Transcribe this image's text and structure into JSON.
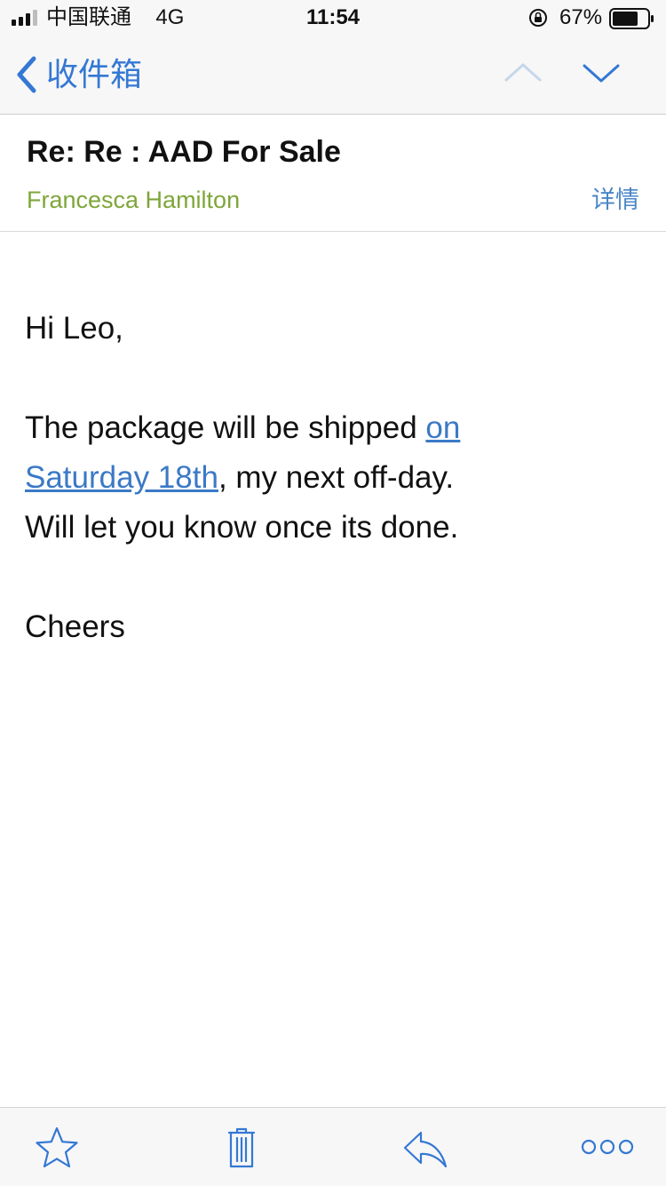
{
  "status_bar": {
    "carrier": "中国联通",
    "network": "4G",
    "time": "11:54",
    "battery_percent": "67%"
  },
  "nav": {
    "back_label": "收件箱",
    "prev_icon": "chevron-up-icon",
    "next_icon": "chevron-down-icon"
  },
  "email": {
    "subject": "Re: Re : AAD For Sale",
    "sender": "Francesca Hamilton",
    "details_label": "详情",
    "greeting": "Hi Leo,",
    "line1_text": "The package will be shipped ",
    "link_part1": "on",
    "link_part2": "Saturday 18th",
    "line2_rest": ", my next off-day.",
    "line3": "Will let you know once its done.",
    "signoff": "Cheers"
  },
  "toolbar": {
    "items": [
      "star-icon",
      "trash-icon",
      "reply-icon",
      "more-icon"
    ]
  },
  "colors": {
    "accent": "#3478d4",
    "sender_green": "#7ea63a",
    "link_blue": "#3b79c6",
    "chrome_bg": "#f7f7f7"
  }
}
